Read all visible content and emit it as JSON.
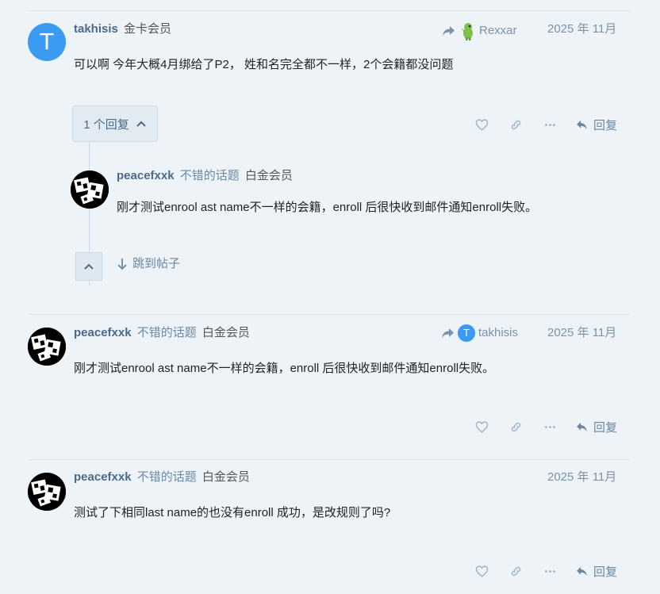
{
  "colors": {
    "accent": "#3b9af2",
    "muted": "#7a93ab",
    "username": "#4a6a8a",
    "background": "#eef3f8"
  },
  "post1": {
    "avatar_letter": "T",
    "username": "takhisis",
    "flair": "金卡会员",
    "reply_to_name": "Rexxar",
    "date": "2025 年 11月",
    "body": "可以啊 今年大概4月绑给了P2， 姓和名完全都不一样，2个会籍都没问题",
    "replies_label": "1 个回复",
    "reply_label": "回复"
  },
  "nested_reply": {
    "username": "peacefxxk",
    "title_badge": "不错的话题",
    "flair": "白金会员",
    "body": "刚才测试enrool ast name不一样的会籍，enroll 后很快收到邮件通知enroll失败。",
    "jump_label": "跳到帖子"
  },
  "post2": {
    "username": "peacefxxk",
    "title_badge": "不错的话题",
    "flair": "白金会员",
    "reply_to_avatar_letter": "T",
    "reply_to_name": "takhisis",
    "date": "2025 年 11月",
    "body": "刚才测试enrool ast name不一样的会籍，enroll 后很快收到邮件通知enroll失败。",
    "reply_label": "回复"
  },
  "post3": {
    "username": "peacefxxk",
    "title_badge": "不错的话题",
    "flair": "白金会员",
    "date": "2025 年 11月",
    "body": "测试了下相同last name的也没有enroll 成功，是改规则了吗?",
    "reply_label": "回复"
  },
  "icons": [
    "share-arrow-icon",
    "dinosaur-avatar-icon",
    "heart-icon",
    "link-icon",
    "more-icon",
    "reply-icon",
    "chevron-up-icon",
    "arrow-down-icon"
  ]
}
